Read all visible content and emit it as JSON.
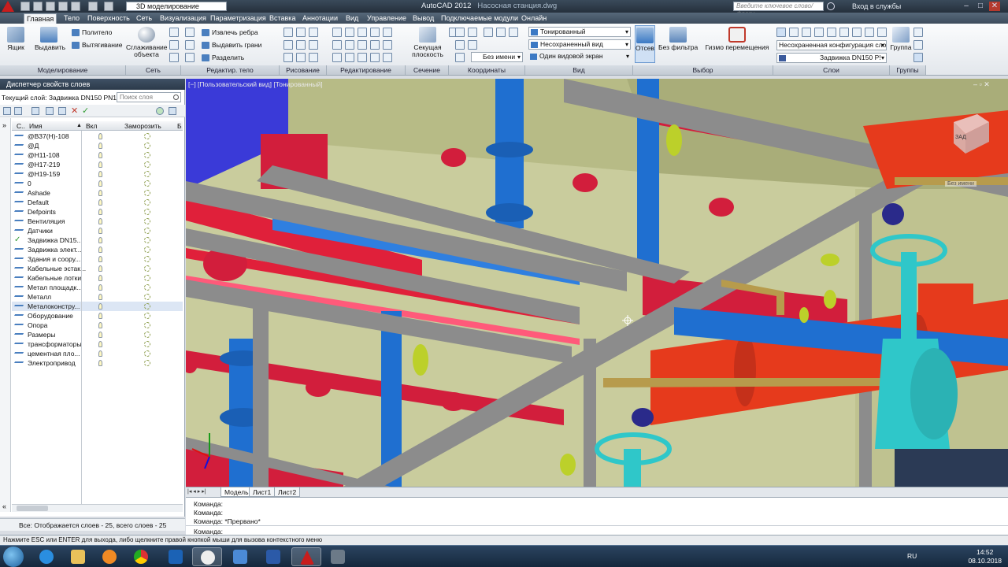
{
  "title": {
    "workspace": "3D моделирование",
    "app": "AutoCAD 2012",
    "file": "Насосная станция.dwg",
    "search_placeholder": "Введите ключевое слово/фразу",
    "signin": "Вход в службы"
  },
  "tabs": [
    "Главная",
    "Тело",
    "Поверхность",
    "Сеть",
    "Визуализация",
    "Параметризация",
    "Вставка",
    "Аннотации",
    "Вид",
    "Управление",
    "Вывод",
    "Подключаемые модули",
    "Онлайн"
  ],
  "ribbon": {
    "modeling": {
      "box": "Ящик",
      "extrude": "Выдавить",
      "polysolid": "Политело",
      "presspull": "Вытягивание",
      "panel": "Моделирование"
    },
    "mesh": {
      "smooth": "Сглаживание объекта",
      "panel": "Сеть"
    },
    "solid_edit": {
      "extract_edges": "Извлечь ребра",
      "extrude_faces": "Выдавить грани",
      "separate": "Разделить",
      "panel": "Редактир. тело"
    },
    "draw": {
      "panel": "Рисование"
    },
    "modify": {
      "panel": "Редактирование"
    },
    "section": {
      "section_plane": "Секущая плоскость",
      "panel": "Сечение"
    },
    "coords": {
      "unnamed": "Без имени",
      "panel": "Координаты"
    },
    "view": {
      "visual_style": "Тонированный",
      "view_name": "Несохраненный вид",
      "viewport_config": "Один видовой экран",
      "panel": "Вид"
    },
    "selection": {
      "culling": "Отсев",
      "no_filter": "Без фильтра",
      "gizmo": "Гизмо перемещения",
      "panel": "Выбор"
    },
    "layers": {
      "layer_state": "Несохраненная конфигурация сло",
      "current_layer": "Задвижка DN150 P!",
      "panel": "Слои"
    },
    "groups": {
      "group": "Группа",
      "panel": "Группы"
    }
  },
  "layer_panel": {
    "header": "Диспетчер свойств слоев",
    "current_layer": "Текущий слой: Задвижка DN150 PN1",
    "search_placeholder": "Поиск слоя",
    "columns": {
      "status": "С..",
      "name": "Имя",
      "on": "Вкл",
      "freeze": "Заморозить",
      "lock": "Б"
    },
    "layers": [
      {
        "name": "@В37(Н)-108",
        "current": false
      },
      {
        "name": "@Д",
        "current": false
      },
      {
        "name": "@Н11-108",
        "current": false
      },
      {
        "name": "@Н17-219",
        "current": false
      },
      {
        "name": "@Н19-159",
        "current": false
      },
      {
        "name": "0",
        "current": false
      },
      {
        "name": "Ashade",
        "current": false
      },
      {
        "name": "Default",
        "current": false
      },
      {
        "name": "Defpoints",
        "current": false
      },
      {
        "name": "Вентиляция",
        "current": false
      },
      {
        "name": "Датчики",
        "current": false
      },
      {
        "name": "Задвижка DN15...",
        "current": true
      },
      {
        "name": "Задвижка элект...",
        "current": false
      },
      {
        "name": "Здания и соору...",
        "current": false
      },
      {
        "name": "Кабельные эстак...",
        "current": false
      },
      {
        "name": "Кабельные лотки",
        "current": false
      },
      {
        "name": "Метал площадк...",
        "current": false
      },
      {
        "name": "Металл",
        "current": false
      },
      {
        "name": "Металоконстру...",
        "current": false
      },
      {
        "name": "Оборудование",
        "current": false
      },
      {
        "name": "Опора",
        "current": false
      },
      {
        "name": "Размеры",
        "current": false
      },
      {
        "name": "трансформаторы",
        "current": false
      },
      {
        "name": "цементная пло...",
        "current": false
      },
      {
        "name": "Электропривод",
        "current": false
      }
    ],
    "status": "Все: Отображается слоев - 25, всего слоев - 25"
  },
  "viewport": {
    "label": "[−] [Пользовательский вид] [Тонированный]",
    "viewcube_top": "ЗАД",
    "viewcube_wcs": "Без имени"
  },
  "layout_tabs": [
    "Модель",
    "Лист1",
    "Лист2"
  ],
  "command_lines": [
    "Команда:",
    "Команда:",
    "Команда:  *Прервано*",
    "Команда:"
  ],
  "statusbar": "Нажмите ESC или ENTER для выхода, либо щелкните правой кнопкой мыши для вызова контекстного меню",
  "taskbar": {
    "lang": "RU",
    "time": "14:52",
    "date": "08.10.2018"
  },
  "colors": {
    "pipe_red": "#e63a1c",
    "pipe_blue": "#1f6fd0",
    "valve_cyan": "#2fc7c9",
    "beam_gray": "#8c8c8c",
    "floor": "#c9cc9d",
    "accent": "#3b79c4"
  }
}
